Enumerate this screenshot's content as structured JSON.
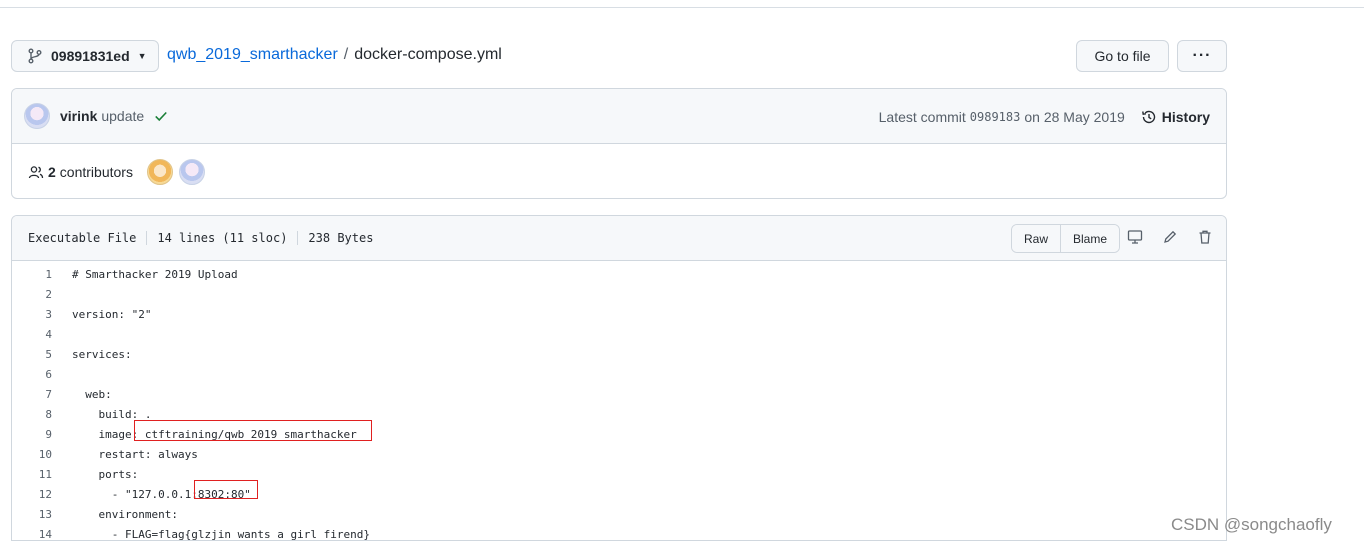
{
  "branch": {
    "label": "09891831ed"
  },
  "breadcrumb": {
    "repo": "qwb_2019_smarthacker",
    "separator": "/",
    "file": "docker-compose.yml"
  },
  "actions": {
    "goto_file": "Go to file",
    "more": "···"
  },
  "commit": {
    "author": "virink",
    "message": "update",
    "latest_prefix": "Latest commit",
    "sha": "0989183",
    "date_text": "on 28 May 2019",
    "history": "History"
  },
  "contributors": {
    "count": "2",
    "label": "contributors"
  },
  "file": {
    "mode": "Executable File",
    "lines": "14 lines (11 sloc)",
    "size": "238 Bytes",
    "raw": "Raw",
    "blame": "Blame"
  },
  "code_lines": [
    {
      "num": "1",
      "text": "# Smarthacker 2019 Upload"
    },
    {
      "num": "2",
      "text": ""
    },
    {
      "num": "3",
      "text": "version: \"2\""
    },
    {
      "num": "4",
      "text": ""
    },
    {
      "num": "5",
      "text": "services:"
    },
    {
      "num": "6",
      "text": ""
    },
    {
      "num": "7",
      "text": "  web:"
    },
    {
      "num": "8",
      "text": "    build: ."
    },
    {
      "num": "9",
      "text": "    image: ctftraining/qwb_2019_smarthacker"
    },
    {
      "num": "10",
      "text": "    restart: always"
    },
    {
      "num": "11",
      "text": "    ports:"
    },
    {
      "num": "12",
      "text": "      - \"127.0.0.1:8302:80\""
    },
    {
      "num": "13",
      "text": "    environment:"
    },
    {
      "num": "14",
      "text": "      - FLAG=flag{glzjin_wants_a_girl_firend}"
    }
  ],
  "watermark": "CSDN @songchaofly",
  "colors": {
    "link": "#0969da",
    "success": "#1a7f37",
    "highlight_box": "#e02020"
  }
}
